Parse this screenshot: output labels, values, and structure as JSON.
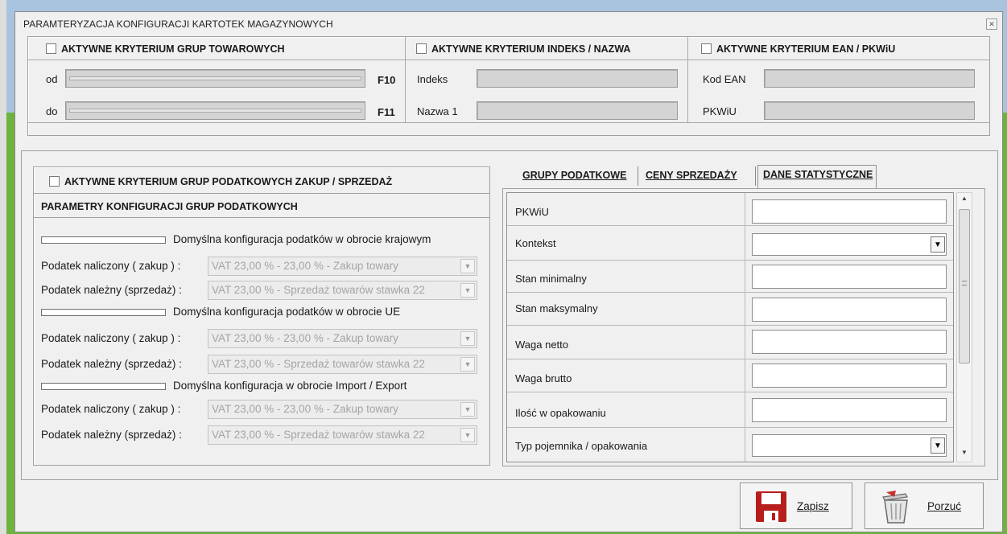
{
  "window": {
    "title": "PARAMTERYZACJA  KONFIGURACJI KARTOTEK MAGAZYNOWYCH",
    "close_icon": "close-icon"
  },
  "top_section": {
    "groups": {
      "header": "AKTYWNE KRYTERIUM GRUP TOWAROWYCH",
      "checked": false,
      "from_label": "od",
      "from_key": "F10",
      "to_label": "do",
      "to_key": "F11"
    },
    "index_name": {
      "header": "AKTYWNE KRYTERIUM  INDEKS / NAZWA",
      "checked": false,
      "index_label": "Indeks",
      "name_label": "Nazwa 1"
    },
    "ean": {
      "header": "AKTYWNE KRYTERIUM EAN / PKWiU",
      "checked": false,
      "ean_label": "Kod EAN",
      "pkwiu_label": "PKWiU"
    }
  },
  "tax_section": {
    "header": "AKTYWNE KRYTERIUM GRUP PODATKOWYCH ZAKUP / SPRZEDAŻ",
    "checked": false,
    "subheader": "PARAMETRY KONFIGURACJI GRUP PODATKOWYCH",
    "blocks": [
      {
        "title": "Domyślna konfiguracja podatków w obrocie krajowym",
        "purchase_label": "Podatek naliczony ( zakup ) :",
        "purchase_value": "VAT 23,00 % - 23,00 %  -  Zakup towary",
        "sale_label": "Podatek należny (sprzedaż) :",
        "sale_value": "VAT 23,00 % - Sprzedaż towarów stawka 22"
      },
      {
        "title": "Domyślna konfiguracja podatków w obrocie UE",
        "purchase_label": "Podatek naliczony ( zakup ) :",
        "purchase_value": "VAT 23,00 % - 23,00 %  -  Zakup towary",
        "sale_label": "Podatek należny (sprzedaż) :",
        "sale_value": "VAT 23,00 % - Sprzedaż towarów stawka 22"
      },
      {
        "title": "Domyślna konfiguracja w obrocie Import / Export",
        "purchase_label": "Podatek naliczony ( zakup ) :",
        "purchase_value": "VAT 23,00 % - 23,00 %  -  Zakup towary",
        "sale_label": "Podatek należny (sprzedaż) :",
        "sale_value": "VAT 23,00 % - Sprzedaż towarów stawka 22"
      }
    ]
  },
  "tabs": [
    {
      "label": "GRUPY PODATKOWE",
      "active": false
    },
    {
      "label": "CENY SPRZEDAŻY",
      "active": false
    },
    {
      "label": "DANE STATYSTYCZNE",
      "active": true
    }
  ],
  "stat_grid": [
    {
      "label": "PKWiU",
      "value": "",
      "type": "text"
    },
    {
      "label": "Kontekst",
      "value": "",
      "type": "dropdown"
    },
    {
      "label": "Stan minimalny",
      "value": "",
      "type": "text"
    },
    {
      "label": "Stan maksymalny",
      "value": "",
      "type": "text"
    },
    {
      "label": "Waga netto",
      "value": "",
      "type": "text"
    },
    {
      "label": "Waga brutto",
      "value": "",
      "type": "text"
    },
    {
      "label": "Ilość w opakowaniu",
      "value": "",
      "type": "text"
    },
    {
      "label": "Typ pojemnika / opakowania",
      "value": "",
      "type": "dropdown"
    }
  ],
  "actions": {
    "save_label": "Zapisz",
    "save_icon": "floppy-disk-icon",
    "cancel_label": "Porzuć",
    "cancel_icon": "trash-bin-icon"
  },
  "colors": {
    "dialog_bg": "#f0f0f0",
    "desktop_green": "#6db33f",
    "save_icon_red": "#b81d1d"
  }
}
